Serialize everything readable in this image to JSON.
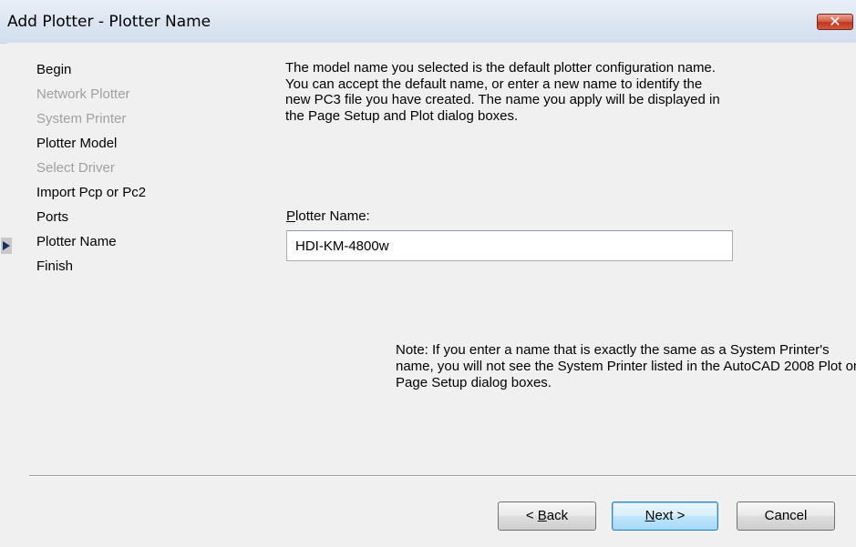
{
  "window": {
    "title": "Add Plotter - Plotter Name",
    "close_glyph": "✕"
  },
  "nav": {
    "items": [
      {
        "label": "Begin",
        "state": "enabled"
      },
      {
        "label": "Network Plotter",
        "state": "disabled"
      },
      {
        "label": "System Printer",
        "state": "disabled"
      },
      {
        "label": "Plotter Model",
        "state": "enabled"
      },
      {
        "label": "Select Driver",
        "state": "disabled"
      },
      {
        "label": "Import Pcp or Pc2",
        "state": "enabled"
      },
      {
        "label": "Ports",
        "state": "enabled"
      },
      {
        "label": "Plotter Name",
        "state": "current"
      },
      {
        "label": "Finish",
        "state": "enabled"
      }
    ],
    "current_indicator_icon": "arrow-right-icon"
  },
  "main": {
    "description": "The model name you selected is the default plotter configuration name. You can accept the default name, or enter a new name to identify the new PC3 file you have created. The name you apply will be displayed in the Page Setup and Plot dialog boxes.",
    "plotter_name_label_mnemonic": "P",
    "plotter_name_label_rest": "lotter Name:",
    "plotter_name_value": "HDI-KM-4800w",
    "note": "Note: If you enter a name that is exactly the same as a System Printer's name, you will not see the System Printer listed in the AutoCAD 2008 Plot or Page Setup dialog boxes."
  },
  "buttons": {
    "back_prefix": "< ",
    "back_mnemonic": "B",
    "back_rest": "ack",
    "next_mnemonic": "N",
    "next_rest": "ext >",
    "cancel": "Cancel"
  },
  "colors": {
    "disabled_text": "#a0a0a0",
    "close_button": "#c7432b",
    "default_button_border": "#3c7fb1"
  }
}
